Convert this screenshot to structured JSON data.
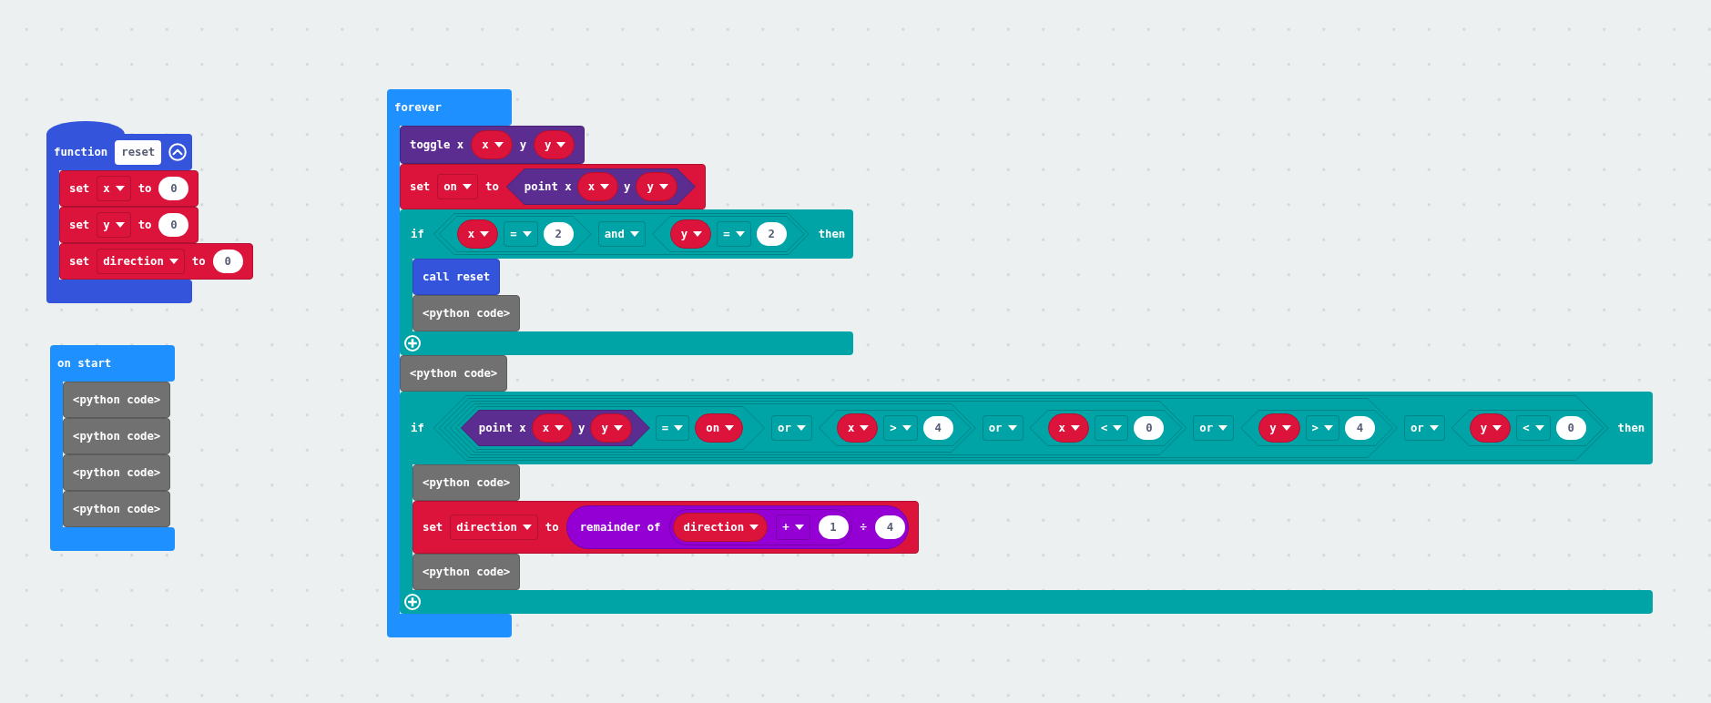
{
  "workspace": {
    "stacks": [
      {
        "kind": "function_definition",
        "parts": [
          {
            "kind": "text",
            "text": "function"
          },
          {
            "kind": "name_field",
            "text": "reset"
          }
        ],
        "body": [
          {
            "kind": "variables_set",
            "parts": [
              {
                "kind": "text",
                "text": "set"
              },
              {
                "kind": "dropdown",
                "text": "x"
              },
              {
                "kind": "text",
                "text": "to"
              },
              {
                "kind": "number",
                "text": "0"
              }
            ]
          },
          {
            "kind": "variables_set",
            "parts": [
              {
                "kind": "text",
                "text": "set"
              },
              {
                "kind": "dropdown",
                "text": "y"
              },
              {
                "kind": "text",
                "text": "to"
              },
              {
                "kind": "number",
                "text": "0"
              }
            ]
          },
          {
            "kind": "variables_set",
            "parts": [
              {
                "kind": "text",
                "text": "set"
              },
              {
                "kind": "dropdown",
                "text": "direction"
              },
              {
                "kind": "text",
                "text": "to"
              },
              {
                "kind": "number",
                "text": "0"
              }
            ]
          }
        ]
      },
      {
        "kind": "event",
        "parts": [
          {
            "kind": "text",
            "text": "on start"
          }
        ],
        "body": [
          {
            "kind": "python",
            "parts": [
              {
                "kind": "text",
                "text": "<python code>"
              }
            ]
          },
          {
            "kind": "python",
            "parts": [
              {
                "kind": "text",
                "text": "<python code>"
              }
            ]
          },
          {
            "kind": "python",
            "parts": [
              {
                "kind": "text",
                "text": "<python code>"
              }
            ]
          },
          {
            "kind": "python",
            "parts": [
              {
                "kind": "text",
                "text": "<python code>"
              }
            ]
          }
        ]
      },
      {
        "kind": "event",
        "parts": [
          {
            "kind": "text",
            "text": "forever"
          }
        ],
        "body": [
          {
            "kind": "led_toggle",
            "parts": [
              {
                "kind": "text",
                "text": "toggle x"
              },
              {
                "kind": "variable",
                "text": "x"
              },
              {
                "kind": "text",
                "text": "y"
              },
              {
                "kind": "variable",
                "text": "y"
              }
            ]
          },
          {
            "kind": "variables_set",
            "parts": [
              {
                "kind": "text",
                "text": "set"
              },
              {
                "kind": "dropdown",
                "text": "on"
              },
              {
                "kind": "text",
                "text": "to"
              },
              {
                "kind": "led_point",
                "parts": [
                  {
                    "kind": "text",
                    "text": "point x"
                  },
                  {
                    "kind": "variable",
                    "text": "x"
                  },
                  {
                    "kind": "text",
                    "text": "y"
                  },
                  {
                    "kind": "variable",
                    "text": "y"
                  }
                ]
              }
            ]
          },
          {
            "kind": "logic_if",
            "parts": [
              {
                "kind": "text",
                "text": "if"
              },
              {
                "kind": "boolean_op",
                "parts": [
                  {
                    "kind": "compare",
                    "parts": [
                      {
                        "kind": "variable",
                        "text": "x"
                      },
                      {
                        "kind": "dropdown",
                        "text": "="
                      },
                      {
                        "kind": "number",
                        "text": "2"
                      }
                    ]
                  },
                  {
                    "kind": "dropdown",
                    "text": "and"
                  },
                  {
                    "kind": "compare",
                    "parts": [
                      {
                        "kind": "variable",
                        "text": "y"
                      },
                      {
                        "kind": "dropdown",
                        "text": "="
                      },
                      {
                        "kind": "number",
                        "text": "2"
                      }
                    ]
                  }
                ]
              },
              {
                "kind": "text",
                "text": "then"
              }
            ],
            "body": [
              {
                "kind": "function_call",
                "parts": [
                  {
                    "kind": "text",
                    "text": "call reset"
                  }
                ]
              },
              {
                "kind": "python",
                "parts": [
                  {
                    "kind": "text",
                    "text": "<python code>"
                  }
                ]
              }
            ]
          },
          {
            "kind": "python",
            "parts": [
              {
                "kind": "text",
                "text": "<python code>"
              }
            ]
          },
          {
            "kind": "logic_if",
            "parts": [
              {
                "kind": "text",
                "text": "if"
              },
              {
                "kind": "boolean_op",
                "parts": [
                  {
                    "kind": "boolean_op",
                    "parts": [
                      {
                        "kind": "boolean_op",
                        "parts": [
                          {
                            "kind": "boolean_op",
                            "parts": [
                              {
                                "kind": "compare",
                                "parts": [
                                  {
                                    "kind": "led_point",
                                    "parts": [
                                      {
                                        "kind": "text",
                                        "text": "point x"
                                      },
                                      {
                                        "kind": "variable",
                                        "text": "x"
                                      },
                                      {
                                        "kind": "text",
                                        "text": "y"
                                      },
                                      {
                                        "kind": "variable",
                                        "text": "y"
                                      }
                                    ]
                                  },
                                  {
                                    "kind": "dropdown",
                                    "text": "="
                                  },
                                  {
                                    "kind": "variable",
                                    "text": "on"
                                  }
                                ]
                              },
                              {
                                "kind": "dropdown",
                                "text": "or"
                              },
                              {
                                "kind": "compare",
                                "parts": [
                                  {
                                    "kind": "variable",
                                    "text": "x"
                                  },
                                  {
                                    "kind": "dropdown",
                                    "text": ">"
                                  },
                                  {
                                    "kind": "number",
                                    "text": "4"
                                  }
                                ]
                              }
                            ]
                          },
                          {
                            "kind": "dropdown",
                            "text": "or"
                          },
                          {
                            "kind": "compare",
                            "parts": [
                              {
                                "kind": "variable",
                                "text": "x"
                              },
                              {
                                "kind": "dropdown",
                                "text": "<"
                              },
                              {
                                "kind": "number",
                                "text": "0"
                              }
                            ]
                          }
                        ]
                      },
                      {
                        "kind": "dropdown",
                        "text": "or"
                      },
                      {
                        "kind": "compare",
                        "parts": [
                          {
                            "kind": "variable",
                            "text": "y"
                          },
                          {
                            "kind": "dropdown",
                            "text": ">"
                          },
                          {
                            "kind": "number",
                            "text": "4"
                          }
                        ]
                      }
                    ]
                  },
                  {
                    "kind": "dropdown",
                    "text": "or"
                  },
                  {
                    "kind": "compare",
                    "parts": [
                      {
                        "kind": "variable",
                        "text": "y"
                      },
                      {
                        "kind": "dropdown",
                        "text": "<"
                      },
                      {
                        "kind": "number",
                        "text": "0"
                      }
                    ]
                  }
                ]
              },
              {
                "kind": "text",
                "text": "then"
              }
            ],
            "body": [
              {
                "kind": "python",
                "parts": [
                  {
                    "kind": "text",
                    "text": "<python code>"
                  }
                ]
              },
              {
                "kind": "variables_set",
                "parts": [
                  {
                    "kind": "text",
                    "text": "set"
                  },
                  {
                    "kind": "dropdown",
                    "text": "direction"
                  },
                  {
                    "kind": "text",
                    "text": "to"
                  },
                  {
                    "kind": "math_remainder",
                    "parts": [
                      {
                        "kind": "text",
                        "text": "remainder of"
                      },
                      {
                        "kind": "math_op",
                        "parts": [
                          {
                            "kind": "variable",
                            "text": "direction"
                          },
                          {
                            "kind": "dropdown",
                            "text": "+"
                          },
                          {
                            "kind": "number",
                            "text": "1"
                          }
                        ]
                      },
                      {
                        "kind": "text",
                        "text": "÷"
                      },
                      {
                        "kind": "number",
                        "text": "4"
                      }
                    ]
                  }
                ]
              },
              {
                "kind": "python",
                "parts": [
                  {
                    "kind": "text",
                    "text": "<python code>"
                  }
                ]
              }
            ]
          }
        ]
      }
    ]
  }
}
